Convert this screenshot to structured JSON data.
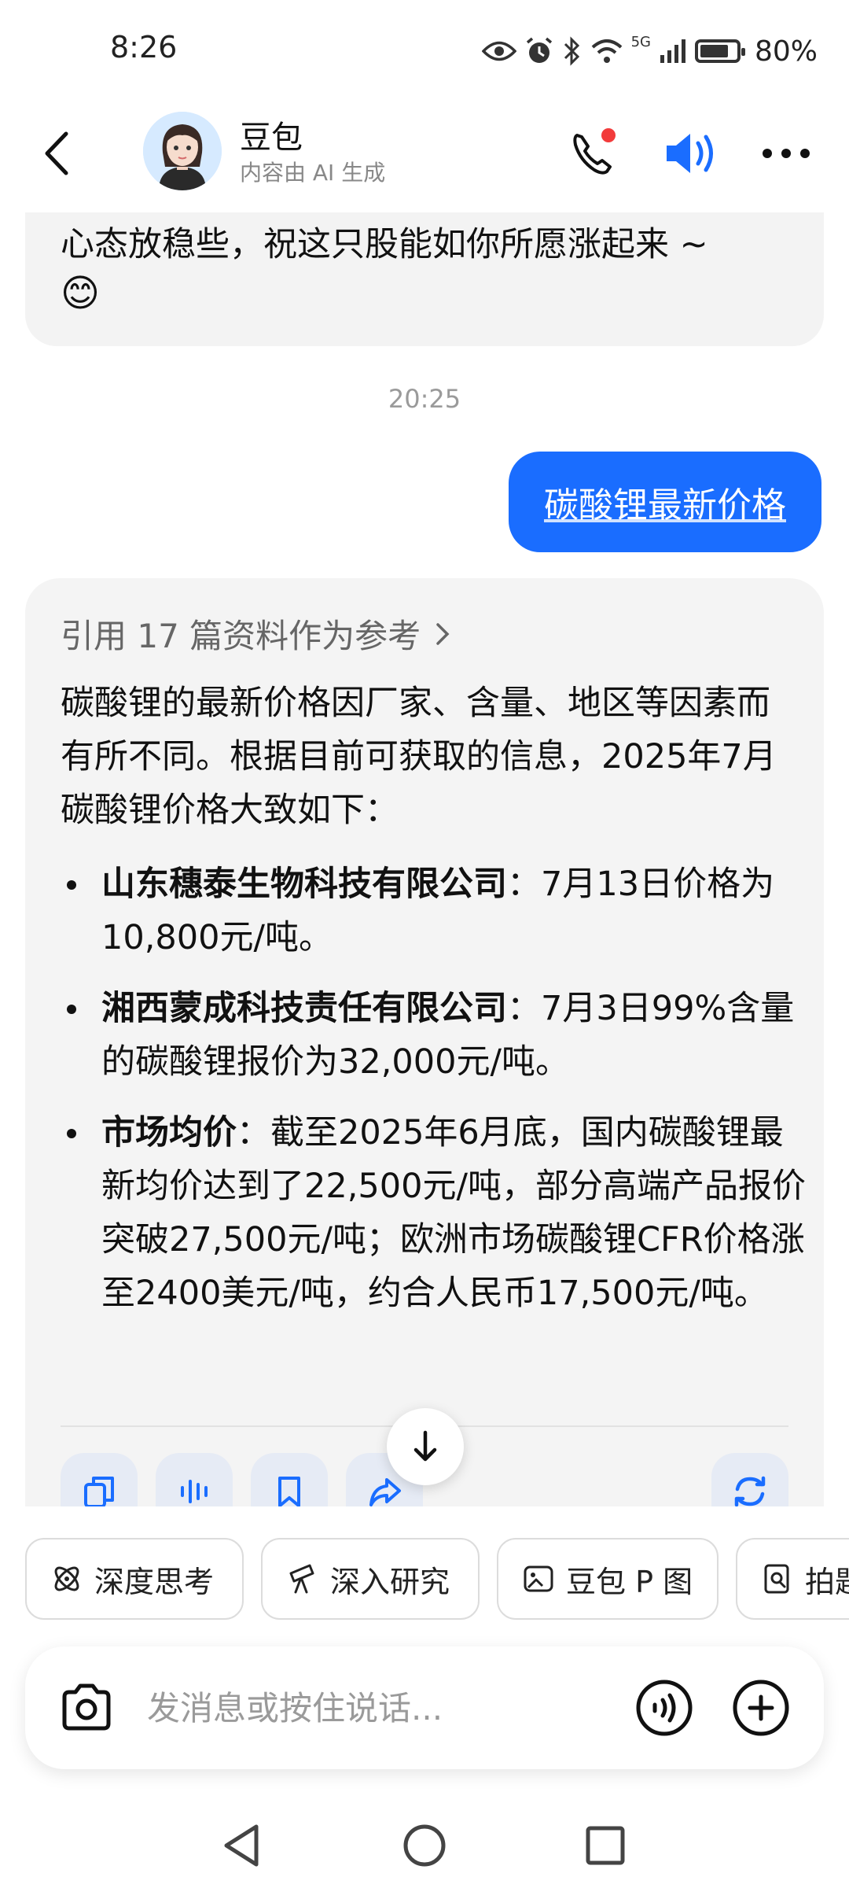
{
  "status_bar": {
    "time": "8:26",
    "network": "5G",
    "battery": "80%",
    "battery_level": 0.8
  },
  "header": {
    "name": "豆包",
    "subtitle": "内容由 AI 生成"
  },
  "chat": {
    "previous_reply": "心态放稳些，祝这只股能如你所愿涨起来 ~",
    "previous_emoji": "😊",
    "timestamp": "20:25",
    "user_message": "碳酸锂最新价格",
    "references": "引用 17 篇资料作为参考",
    "intro": "碳酸锂的最新价格因厂家、含量、地区等因素而有所不同。根据目前可获取的信息，2025年7月碳酸锂价格大致如下：",
    "items": [
      {
        "title": "山东穗泰生物科技有限公司",
        "text": "：7月13日价格为10,800元/吨。"
      },
      {
        "title": "湘西蒙成科技责任有限公司",
        "text": "：7月3日99%含量的碳酸锂报价为32,000元/吨。"
      },
      {
        "title": "市场均价",
        "text": "：截至2025年6月底，国内碳酸锂最新均价达到了22,500元/吨，部分高端产品报价突破27,500元/吨；欧洲市场碳酸锂CFR价格涨至2400美元/吨，约合人民币17,500元/吨。"
      }
    ]
  },
  "chips": [
    "深度思考",
    "深入研究",
    "豆包 P 图",
    "拍题"
  ],
  "input": {
    "placeholder": "发消息或按住说话..."
  },
  "colors": {
    "accent": "#1a6dff",
    "bubble_bg": "#f4f4f4",
    "action_bg": "#e6ebf5"
  }
}
